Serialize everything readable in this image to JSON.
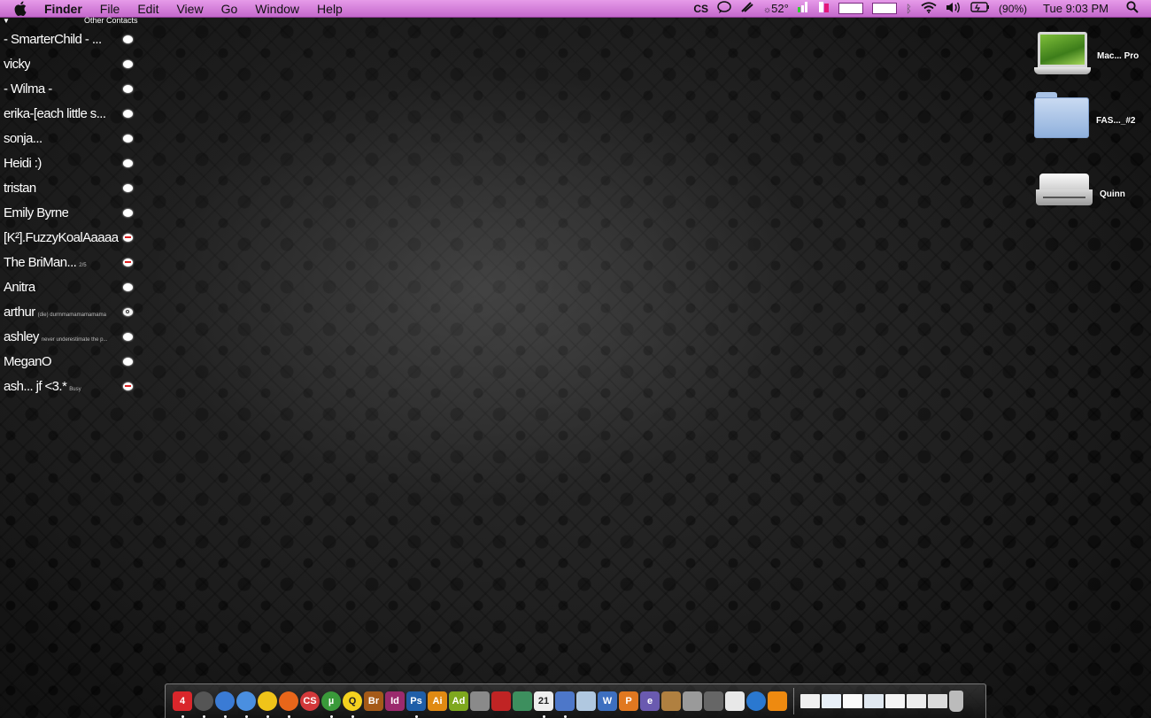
{
  "menubar": {
    "app_name": "Finder",
    "menus": [
      "File",
      "Edit",
      "View",
      "Go",
      "Window",
      "Help"
    ],
    "tray": {
      "temperature": "52°",
      "battery": "(90%)",
      "clock": "Tue 9:03 PM"
    },
    "icons": [
      "apple-icon",
      "creative-suite-icon",
      "chat-bubble-icon",
      "script-icon",
      "weather-icon",
      "memory-meter-icon",
      "cpu-meter-icon",
      "network-meter-icon",
      "bluetooth-icon",
      "wifi-icon",
      "volume-icon",
      "battery-icon",
      "spotlight-icon"
    ]
  },
  "buddy_list": {
    "group": "Other Contacts",
    "buddies": [
      {
        "name": "- SmarterChild - ...",
        "msg": "",
        "status": "available"
      },
      {
        "name": "vicky",
        "msg": "",
        "status": "available"
      },
      {
        "name": "- Wilma -",
        "msg": "",
        "status": "available"
      },
      {
        "name": "erika-[each little s...",
        "msg": "",
        "status": "available"
      },
      {
        "name": "sonja...",
        "msg": "",
        "status": "available"
      },
      {
        "name": "Heidi :)",
        "msg": "",
        "status": "available"
      },
      {
        "name": "tristan",
        "msg": "",
        "status": "available"
      },
      {
        "name": "Emily Byrne",
        "msg": "",
        "status": "available"
      },
      {
        "name": "[K²].FuzzyKoalAaaaa",
        "msg": "",
        "status": "away"
      },
      {
        "name": "The BriMan...",
        "msg": "2/5",
        "status": "away"
      },
      {
        "name": "Anitra",
        "msg": "",
        "status": "available"
      },
      {
        "name": "arthur",
        "msg": "(die) durmmamamamamama",
        "status": "idle"
      },
      {
        "name": "ashley",
        "msg": "never underestimate the p...",
        "status": "available"
      },
      {
        "name": "MeganO",
        "msg": "",
        "status": "available"
      },
      {
        "name": "ash... jf <3.*",
        "msg": "Busy",
        "status": "away"
      }
    ]
  },
  "desktop": {
    "items": [
      {
        "label": "Mac... Pro",
        "icon": "laptop-icon"
      },
      {
        "label": "FAS..._#2",
        "icon": "folder-icon"
      },
      {
        "label": "Quinn",
        "icon": "hard-drive-icon"
      }
    ]
  },
  "dock": {
    "apps": [
      {
        "name": "calendar-app-icon",
        "glyph": "4",
        "color": "#d9262b",
        "running": true
      },
      {
        "name": "dashboard-icon",
        "glyph": "",
        "color": "#555555",
        "running": true
      },
      {
        "name": "safari-icon",
        "glyph": "",
        "color": "#3a7bd5",
        "running": true
      },
      {
        "name": "finder-icon",
        "glyph": "",
        "color": "#4a8fe0",
        "running": true
      },
      {
        "name": "adium-icon",
        "glyph": "",
        "color": "#f0c419",
        "running": true
      },
      {
        "name": "firefox-icon",
        "glyph": "",
        "color": "#e8661a",
        "running": true
      },
      {
        "name": "creative-suite-icon",
        "glyph": "CS",
        "color": "#d3383a",
        "running": false
      },
      {
        "name": "utorrent-icon",
        "glyph": "µ",
        "color": "#3a9a3a",
        "running": true
      },
      {
        "name": "quicksilver-icon",
        "glyph": "Q",
        "color": "#f4d21e",
        "running": true
      },
      {
        "name": "bridge-icon",
        "glyph": "Br",
        "color": "#a55a18",
        "running": false
      },
      {
        "name": "indesign-icon",
        "glyph": "Id",
        "color": "#9b2a6d",
        "running": false
      },
      {
        "name": "photoshop-icon",
        "glyph": "Ps",
        "color": "#1f5ea8",
        "running": true
      },
      {
        "name": "illustrator-icon",
        "glyph": "Ai",
        "color": "#e08a12",
        "running": false
      },
      {
        "name": "acrobat-icon",
        "glyph": "Ad",
        "color": "#7ea81e",
        "running": false
      },
      {
        "name": "photo-booth-icon",
        "glyph": "",
        "color": "#8a8a8a",
        "running": false
      },
      {
        "name": "textbook-icon",
        "glyph": "",
        "color": "#c02424",
        "running": false
      },
      {
        "name": "preview-icon",
        "glyph": "",
        "color": "#3d8f5e",
        "running": false
      },
      {
        "name": "ical-icon",
        "glyph": "21",
        "color": "#eeeeee",
        "running": true
      },
      {
        "name": "mail-icon",
        "glyph": "",
        "color": "#4d77c9",
        "running": true
      },
      {
        "name": "iphoto-icon",
        "glyph": "",
        "color": "#b0c8e0",
        "running": false
      },
      {
        "name": "word-icon",
        "glyph": "W",
        "color": "#3d6fc0",
        "running": false
      },
      {
        "name": "powerpoint-icon",
        "glyph": "P",
        "color": "#e07820",
        "running": false
      },
      {
        "name": "entourage-icon",
        "glyph": "e",
        "color": "#6a5ab0",
        "running": false
      },
      {
        "name": "garageband-icon",
        "glyph": "",
        "color": "#b08040",
        "running": false
      },
      {
        "name": "script-editor-icon",
        "glyph": "",
        "color": "#9a9a9a",
        "running": false
      },
      {
        "name": "camera-icon",
        "glyph": "",
        "color": "#666666",
        "running": false
      },
      {
        "name": "textedit-icon",
        "glyph": "",
        "color": "#e8e8e8",
        "running": false
      },
      {
        "name": "quicktime-icon",
        "glyph": "",
        "color": "#2a78d0",
        "running": false
      },
      {
        "name": "vlc-icon",
        "glyph": "",
        "color": "#ee8a10",
        "running": false
      }
    ],
    "stack_items": [
      {
        "name": "minimized-window-1-icon",
        "color": "#f0f0f0"
      },
      {
        "name": "minimized-window-2-icon",
        "color": "#e8f0f8"
      },
      {
        "name": "minimized-window-3-icon",
        "color": "#fafafa"
      },
      {
        "name": "minimized-window-4-icon",
        "color": "#e0e8f0"
      },
      {
        "name": "minimized-window-5-icon",
        "color": "#f4f4f4"
      },
      {
        "name": "minimized-window-6-icon",
        "color": "#ececec"
      },
      {
        "name": "minimized-window-7-icon",
        "color": "#dcdcdc"
      },
      {
        "name": "trash-icon",
        "color": "#bbbbbb"
      }
    ]
  }
}
